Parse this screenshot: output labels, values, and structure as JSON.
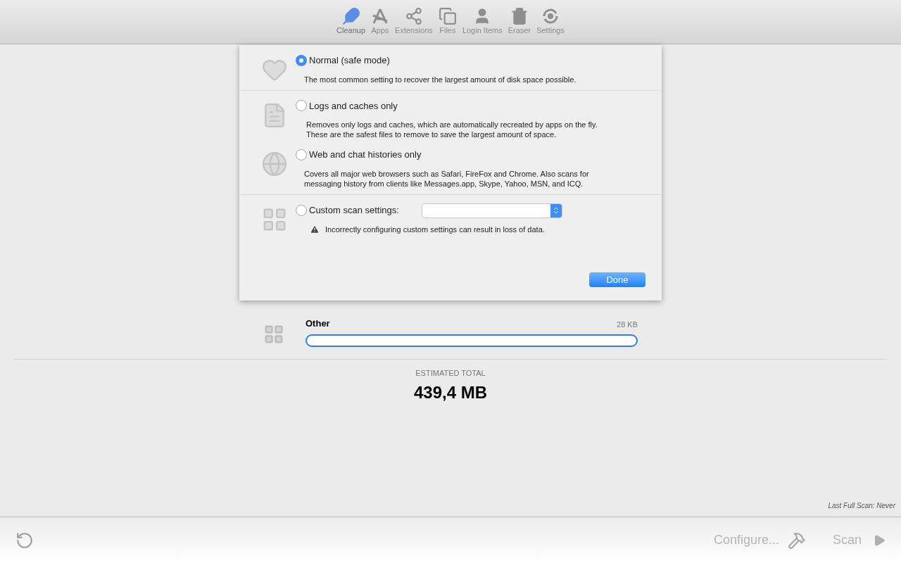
{
  "toolbar": {
    "tabs": [
      {
        "label": "Cleanup",
        "selected": true
      },
      {
        "label": "Apps",
        "selected": false
      },
      {
        "label": "Extensions",
        "selected": false
      },
      {
        "label": "Files",
        "selected": false
      },
      {
        "label": "Login Items",
        "selected": false
      },
      {
        "label": "Eraser",
        "selected": false
      },
      {
        "label": "Settings",
        "selected": false
      }
    ]
  },
  "categories": [
    {
      "name": "Other",
      "size": "28 KB",
      "level": 0
    }
  ],
  "total": {
    "label": "ESTIMATED TOTAL",
    "value": "439,4 MB"
  },
  "last_scan": "Last Full Scan: Never",
  "bottom_bar": {
    "configure": "Configure...",
    "scan": "Scan"
  },
  "dialog": {
    "options": [
      {
        "kind": "plain",
        "label": "Normal (safe mode)",
        "selected": true,
        "separated": false,
        "lines": [
          "The most common setting to recover the largest amount of disk space possible."
        ]
      },
      {
        "kind": "plain",
        "label": "Logs and caches only",
        "selected": false,
        "separated": true,
        "lines": [
          "Removes only logs and caches, which are automatically recreated by apps on the fly.",
          "These are the safest files to remove to save the largest amount of space."
        ]
      },
      {
        "kind": "plain",
        "label": "Web and chat histories only",
        "selected": false,
        "separated": false,
        "lines": [
          "Covers all major web browsers such as Safari, FireFox and Chrome. Also scans for",
          "messaging history from clients like Messages.app, Skype, Yahoo, MSN, and ICQ."
        ]
      },
      {
        "kind": "custom",
        "label": "Custom scan settings:",
        "selected": false,
        "separated": true,
        "lines": [
          "Incorrectly configuring custom settings can result in loss of data."
        ]
      }
    ],
    "done": "Done"
  }
}
